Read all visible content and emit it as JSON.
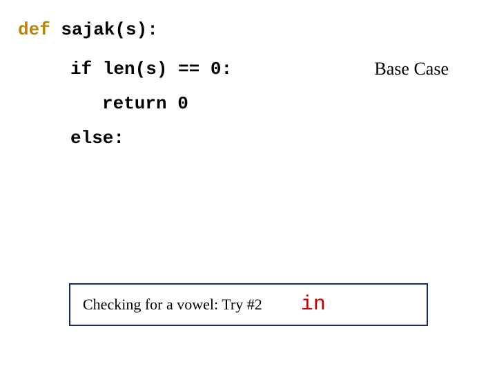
{
  "code": {
    "def_kw": "def",
    "funcname": " sajak(s):",
    "if_kw": "if",
    "if_rest": " len(s) == 0:",
    "return_kw": "return",
    "return_val": " 0",
    "else_kw": "else",
    "else_colon": ":"
  },
  "annotation": {
    "base_case": "Base Case"
  },
  "box": {
    "text": "Checking for a vowel:  Try #2",
    "in_kw": "in"
  }
}
